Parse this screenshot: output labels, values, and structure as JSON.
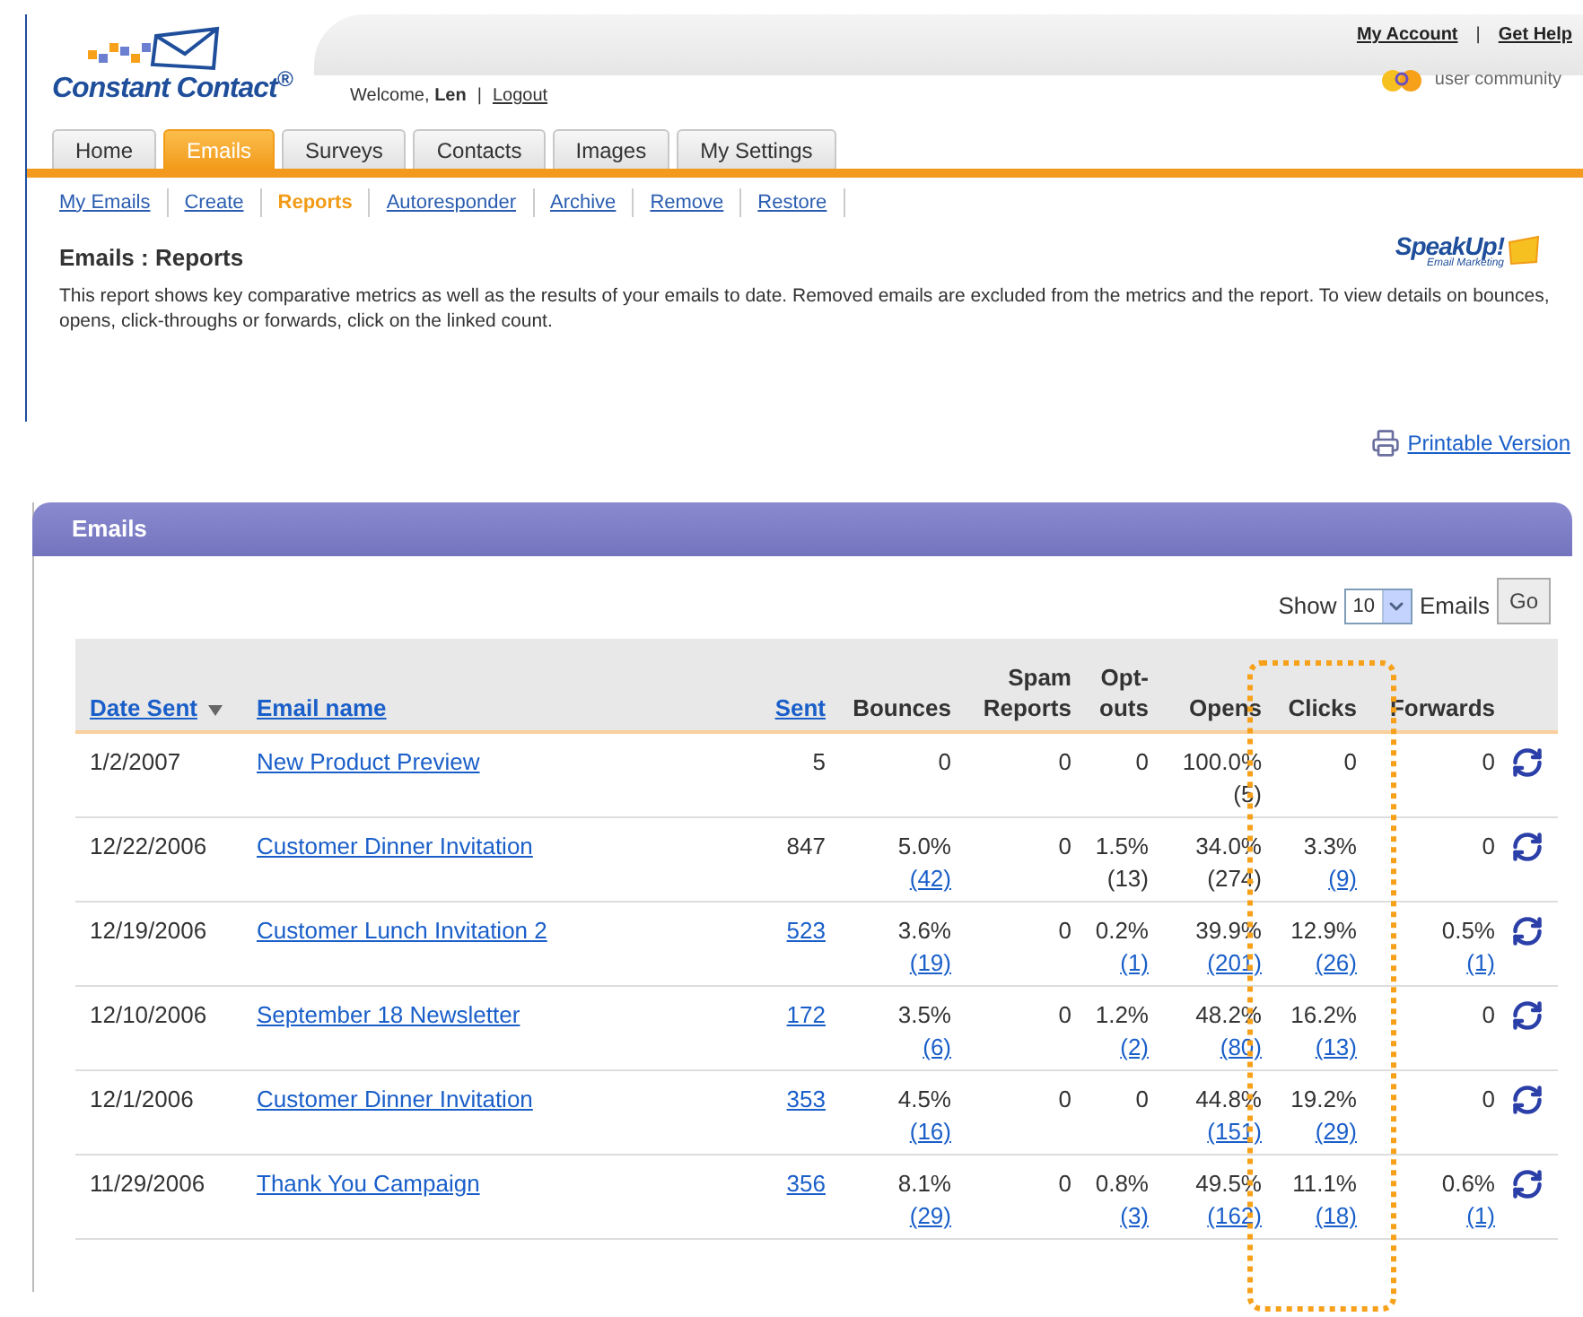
{
  "top_links": {
    "links": [
      "My Account",
      "Get Help"
    ],
    "separator": "|"
  },
  "logo": {
    "text": "Constant Contact$^{®}$"
  },
  "welcome": {
    "text": "Welcome, **Len**",
    "separator": "|",
    "logout": "Logout"
  },
  "community": "user community",
  "nav_tabs": [
    {
      "label": "Home",
      "selected": false
    },
    {
      "label": "Emails",
      "selected": true
    },
    {
      "label": "Surveys",
      "selected": false
    },
    {
      "label": "Contacts",
      "selected": false
    },
    {
      "label": "Images",
      "selected": false
    },
    {
      "label": "My Settings",
      "selected": false
    }
  ],
  "sub_nav": [
    {
      "label": "My Emails",
      "selected": false
    },
    {
      "label": "Create",
      "selected": false
    },
    {
      "label": "Reports",
      "selected": true
    },
    {
      "label": "Autoresponder",
      "selected": false
    },
    {
      "label": "Archive",
      "selected": false
    },
    {
      "label": "Remove",
      "selected": false
    },
    {
      "label": "Restore",
      "selected": false
    }
  ],
  "page_title": "Emails : Reports",
  "badge": {
    "title": "SpeakUp!",
    "subtitle": "Email Marketing"
  },
  "description": "This report shows key comparative metrics as well as the results of your emails to date. Removed emails are excluded from the metrics and the report. To view details on bounces, opens, click-throughs or forwards, click on the linked count.",
  "printable": "Printable Version",
  "panel": {
    "title": "Emails",
    "show_label": "Show",
    "show_value": "10",
    "show_suffix": "Emails",
    "go": "Go"
  },
  "table": {
    "columns": [
      {
        "label": "Date Sent",
        "link": true,
        "sorted": true
      },
      {
        "label": "Email name",
        "link": true,
        "sorted": false
      },
      {
        "label": "Sent",
        "link": true,
        "sorted": false
      },
      {
        "label": "Bounces",
        "link": false,
        "sorted": false
      },
      {
        "label": "Spam Reports",
        "link": false,
        "sorted": false
      },
      {
        "label": "Opt-outs",
        "link": false,
        "sorted": false
      },
      {
        "label": "Opens",
        "link": false,
        "sorted": false
      },
      {
        "label": "Clicks",
        "link": false,
        "sorted": false
      },
      {
        "label": "Forwards",
        "link": false,
        "sorted": false
      }
    ],
    "rows": [
      {
        "cells": [
          [
            {
              "text": "1/2/2007",
              "link": false
            }
          ],
          [
            {
              "text": "New Product Preview",
              "link": true
            }
          ],
          [
            {
              "text": "5",
              "link": false
            }
          ],
          [
            {
              "text": "0",
              "link": false
            }
          ],
          [
            {
              "text": "0",
              "link": false
            }
          ],
          [
            {
              "text": "0",
              "link": false
            }
          ],
          [
            {
              "text": "100.0%",
              "link": false
            },
            {
              "text": "(5)",
              "link": false
            }
          ],
          [
            {
              "text": "0",
              "link": false
            }
          ],
          [
            {
              "text": "0",
              "link": false
            }
          ]
        ]
      },
      {
        "cells": [
          [
            {
              "text": "12/22/2006",
              "link": false
            }
          ],
          [
            {
              "text": "Customer Dinner Invitation",
              "link": true
            }
          ],
          [
            {
              "text": "847",
              "link": false
            }
          ],
          [
            {
              "text": "5.0%",
              "link": false
            },
            {
              "text": "(42)",
              "link": true
            }
          ],
          [
            {
              "text": "0",
              "link": false
            }
          ],
          [
            {
              "text": "1.5%",
              "link": false
            },
            {
              "text": "(13)",
              "link": false
            }
          ],
          [
            {
              "text": "34.0%",
              "link": false
            },
            {
              "text": "(274)",
              "link": false
            }
          ],
          [
            {
              "text": "3.3%",
              "link": false
            },
            {
              "text": "(9)",
              "link": true
            }
          ],
          [
            {
              "text": "0",
              "link": false
            }
          ]
        ]
      },
      {
        "cells": [
          [
            {
              "text": "12/19/2006",
              "link": false
            }
          ],
          [
            {
              "text": "Customer Lunch Invitation 2",
              "link": true
            }
          ],
          [
            {
              "text": "523",
              "link": true
            }
          ],
          [
            {
              "text": "3.6%",
              "link": false
            },
            {
              "text": "(19)",
              "link": true
            }
          ],
          [
            {
              "text": "0",
              "link": false
            }
          ],
          [
            {
              "text": "0.2%",
              "link": false
            },
            {
              "text": "(1)",
              "link": true
            }
          ],
          [
            {
              "text": "39.9%",
              "link": false
            },
            {
              "text": "(201)",
              "link": true
            }
          ],
          [
            {
              "text": "12.9%",
              "link": false
            },
            {
              "text": "(26)",
              "link": true
            }
          ],
          [
            {
              "text": "0.5%",
              "link": false
            },
            {
              "text": "(1)",
              "link": true
            }
          ]
        ]
      },
      {
        "cells": [
          [
            {
              "text": "12/10/2006",
              "link": false
            }
          ],
          [
            {
              "text": "September 18 Newsletter",
              "link": true
            }
          ],
          [
            {
              "text": "172",
              "link": true
            }
          ],
          [
            {
              "text": "3.5%",
              "link": false
            },
            {
              "text": "(6)",
              "link": true
            }
          ],
          [
            {
              "text": "0",
              "link": false
            }
          ],
          [
            {
              "text": "1.2%",
              "link": false
            },
            {
              "text": "(2)",
              "link": true
            }
          ],
          [
            {
              "text": "48.2%",
              "link": false
            },
            {
              "text": "(80)",
              "link": true
            }
          ],
          [
            {
              "text": "16.2%",
              "link": false
            },
            {
              "text": "(13)",
              "link": true
            }
          ],
          [
            {
              "text": "0",
              "link": false
            }
          ]
        ]
      },
      {
        "cells": [
          [
            {
              "text": "12/1/2006",
              "link": false
            }
          ],
          [
            {
              "text": "Customer Dinner Invitation",
              "link": true
            }
          ],
          [
            {
              "text": "353",
              "link": true
            }
          ],
          [
            {
              "text": "4.5%",
              "link": false
            },
            {
              "text": "(16)",
              "link": true
            }
          ],
          [
            {
              "text": "0",
              "link": false
            }
          ],
          [
            {
              "text": "0",
              "link": false
            }
          ],
          [
            {
              "text": "44.8%",
              "link": false
            },
            {
              "text": "(151)",
              "link": true
            }
          ],
          [
            {
              "text": "19.2%",
              "link": false
            },
            {
              "text": "(29)",
              "link": true
            }
          ],
          [
            {
              "text": "0",
              "link": false
            }
          ]
        ]
      },
      {
        "cells": [
          [
            {
              "text": "11/29/2006",
              "link": false
            }
          ],
          [
            {
              "text": "Thank You Campaign",
              "link": true
            }
          ],
          [
            {
              "text": "356",
              "link": true
            }
          ],
          [
            {
              "text": "8.1%",
              "link": false
            },
            {
              "text": "(29)",
              "link": true
            }
          ],
          [
            {
              "text": "0",
              "link": false
            }
          ],
          [
            {
              "text": "0.8%",
              "link": false
            },
            {
              "text": "(3)",
              "link": true
            }
          ],
          [
            {
              "text": "49.5%",
              "link": false
            },
            {
              "text": "(162)",
              "link": true
            }
          ],
          [
            {
              "text": "11.1%",
              "link": false
            },
            {
              "text": "(18)",
              "link": true
            }
          ],
          [
            {
              "text": "0.6%",
              "link": false
            },
            {
              "text": "(1)",
              "link": true
            }
          ]
        ]
      }
    ]
  }
}
